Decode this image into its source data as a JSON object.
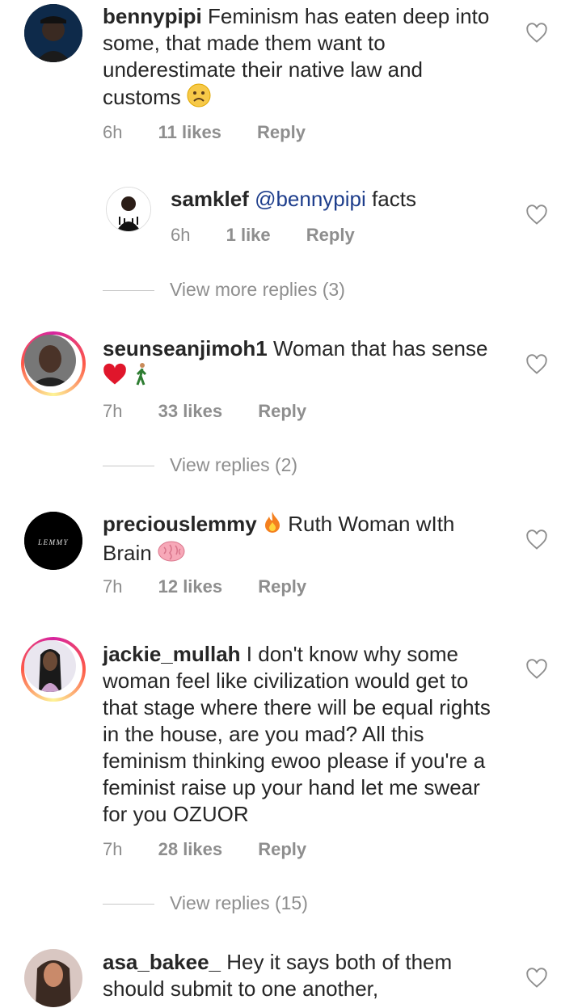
{
  "comments": [
    {
      "username": "bennypipi",
      "text": "Feminism has eaten deep into some, that made them want to underestimate their native law and customs",
      "emoji": "worried-face",
      "time": "6h",
      "likes": "11 likes",
      "reply_label": "Reply"
    },
    {
      "username": "samklef",
      "mention": "@bennypipi",
      "text": "facts",
      "time": "6h",
      "likes": "1 like",
      "reply_label": "Reply"
    },
    {
      "username": "seunseanjimoh1",
      "text": "Woman that has sense",
      "emoji": "heart walking-man",
      "time": "7h",
      "likes": "33 likes",
      "reply_label": "Reply"
    },
    {
      "username": "preciouslemmy",
      "text": "Ruth Woman wIth Brain",
      "emoji": "fire brain",
      "time": "7h",
      "likes": "12 likes",
      "reply_label": "Reply",
      "avatar_text": "LEMMY"
    },
    {
      "username": "jackie_mullah",
      "text": "I don't know why some woman feel like civilization would get to that stage where there will be equal rights in the house, are you mad? All this feminism thinking ewoo  please if you're a feminist raise up your hand let me swear for you OZUOR",
      "time": "7h",
      "likes": "28 likes",
      "reply_label": "Reply"
    },
    {
      "username": "asa_bakee_",
      "text": "Hey it says both of them should submit to one another,"
    }
  ],
  "view_replies": [
    "View more replies (3)",
    "View replies (2)",
    "View replies (15)"
  ],
  "colors": {
    "text": "#262626",
    "meta": "#8e8e8e",
    "mention": "#1e3e8c"
  }
}
